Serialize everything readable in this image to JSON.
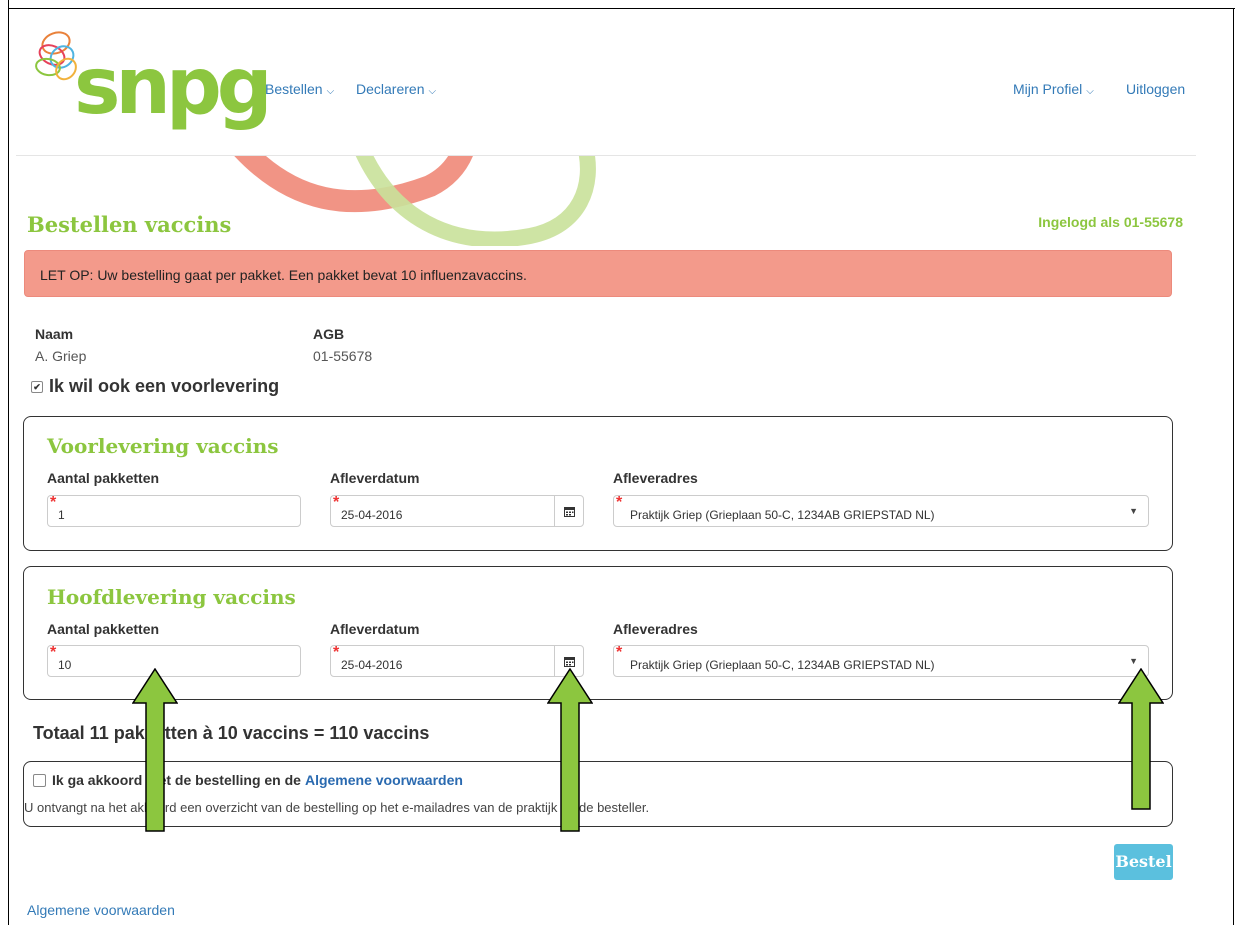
{
  "brand": {
    "logo_text": "snpg",
    "green": "#8cc63f",
    "link_blue": "#337ab7"
  },
  "nav": {
    "left": [
      {
        "label": "Bestellen",
        "icon": "chevron-down-icon"
      },
      {
        "label": "Declareren",
        "icon": "chevron-down-icon"
      }
    ],
    "right": [
      {
        "label": "Mijn Profiel",
        "icon": "chevron-down-icon"
      },
      {
        "label": "Uitloggen"
      }
    ]
  },
  "page": {
    "title": "Bestellen vaccins",
    "logged_in": "Ingelogd als 01-55678",
    "alert": "LET OP: Uw bestelling gaat per pakket. Een pakket bevat 10 influenzavaccins."
  },
  "customer": {
    "name_label": "Naam",
    "name_value": "A. Griep",
    "agb_label": "AGB",
    "agb_value": "01-55678"
  },
  "pre_delivery_checkbox": {
    "label": "Ik wil ook een voorlevering",
    "checked": true,
    "mark": "✔"
  },
  "pre_delivery": {
    "title": "Voorlevering vaccins",
    "qty_label": "Aantal pakketten",
    "qty_value": "1",
    "date_label": "Afleverdatum",
    "date_value": "25-04-2016",
    "address_label": "Afleveradres",
    "address_value": "Praktijk Griep (Grieplaan 50-C, 1234AB GRIEPSTAD NL)",
    "required_mark": "*",
    "calendar_icon": "calendar-icon"
  },
  "main_delivery": {
    "title": "Hoofdlevering vaccins",
    "qty_label": "Aantal pakketten",
    "qty_value": "10",
    "date_label": "Afleverdatum",
    "date_value": "25-04-2016",
    "address_label": "Afleveradres",
    "address_value": "Praktijk Griep (Grieplaan 50-C, 1234AB GRIEPSTAD NL)",
    "required_mark": "*",
    "calendar_icon": "calendar-icon"
  },
  "total": "Totaal 11 pakketten à 10 vaccins = 110 vaccins",
  "agreement": {
    "label": "Ik ga akkoord met de bestelling en de",
    "link": "Algemene voorwaarden",
    "info": "U ontvangt na het akkoord een overzicht van de bestelling op het e-mailadres van de praktijk en de besteller.",
    "checked": false
  },
  "submit_label": "Bestel",
  "footer_link": "Algemene voorwaarden",
  "annotation_arrow_color": "#8cc63f"
}
